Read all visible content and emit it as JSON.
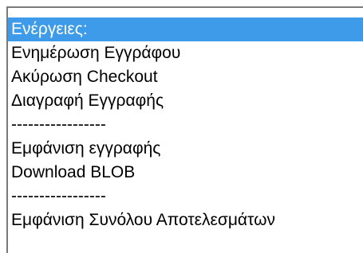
{
  "colors": {
    "selection_background": "#3d9be9",
    "selection_text": "#ffffff",
    "text": "#000000"
  },
  "listbox": {
    "selected_index": 0,
    "options": [
      "Ενέργειες:",
      "Ενημέρωση Εγγράφου",
      "Ακύρωση Checkout",
      "Διαγραφή Εγγραφής",
      "-----------------",
      "Εμφάνιση εγγραφής",
      "Download BLOB",
      "-----------------",
      "Εμφάνιση Συνόλου Αποτελεσμάτων"
    ]
  }
}
